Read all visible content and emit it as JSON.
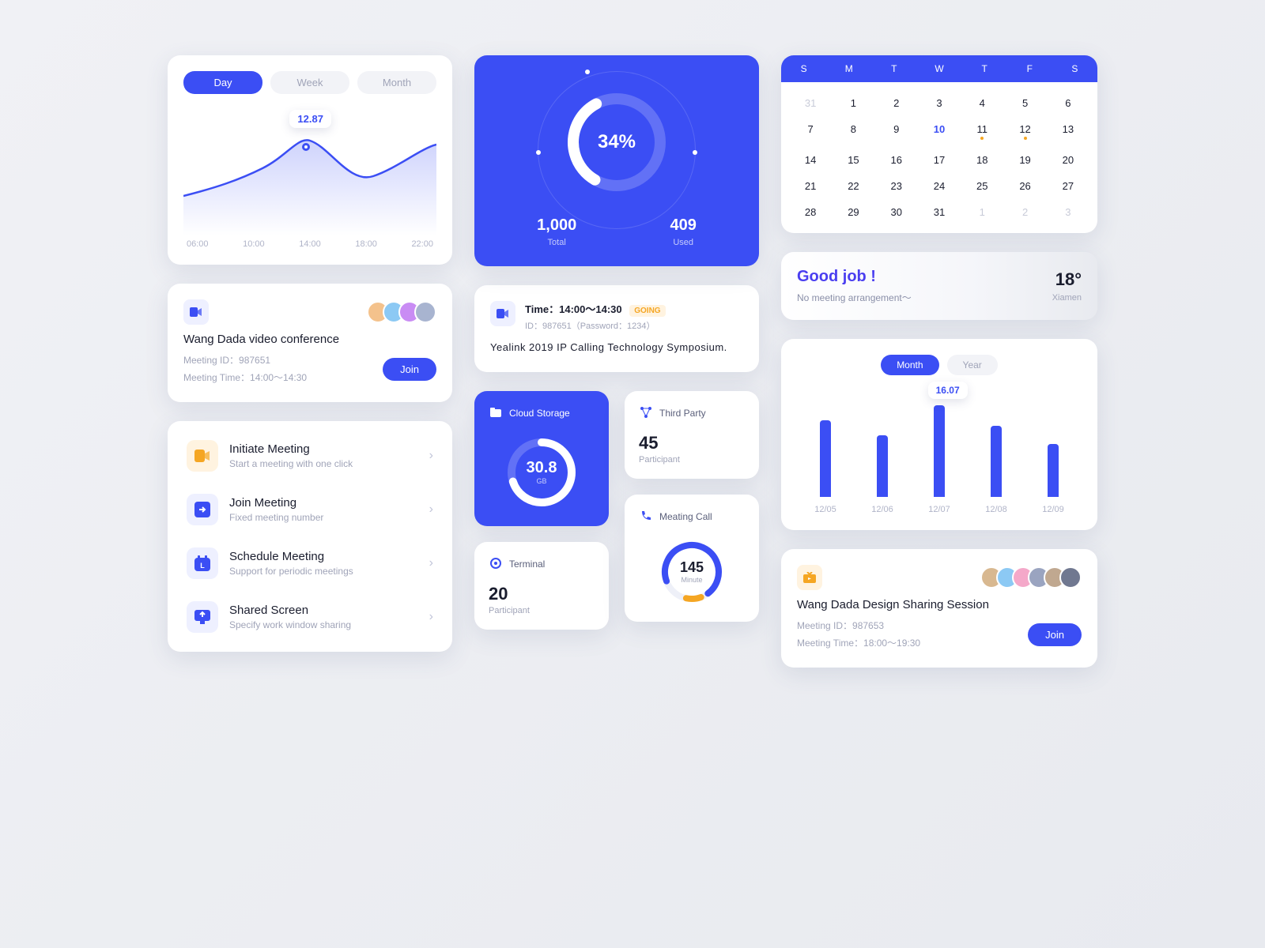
{
  "lineChart": {
    "tabs": [
      "Day",
      "Week",
      "Month"
    ],
    "activeTab": 0,
    "xaxis": [
      "06:00",
      "10:00",
      "14:00",
      "18:00",
      "22:00"
    ],
    "tooltipValue": "12.87"
  },
  "chart_data": [
    {
      "type": "line",
      "title": "",
      "x": [
        "06:00",
        "10:00",
        "14:00",
        "18:00",
        "22:00"
      ],
      "values": [
        6.5,
        8.5,
        12.87,
        9.2,
        11.8
      ],
      "highlight": {
        "x": "14:00",
        "value": 12.87
      },
      "ylim": [
        0,
        16
      ]
    },
    {
      "type": "bar",
      "title": "",
      "categories": [
        "12/05",
        "12/06",
        "12/07",
        "12/08",
        "12/09"
      ],
      "values": [
        13.5,
        10.8,
        16.07,
        12.5,
        9.3
      ],
      "highlight": {
        "x": "12/07",
        "value": 16.07
      },
      "ylim": [
        0,
        18
      ]
    }
  ],
  "meeting1": {
    "title": "Wang Dada  video conference",
    "idLabel": "Meeting ID：",
    "id": "987651",
    "timeLabel": "Meeting Time：",
    "time": "14:00～14:30",
    "joinLabel": "Join",
    "avatarColors": [
      "#f4c28c",
      "#8cc9f4",
      "#c98cf4",
      "#a8b4d0"
    ]
  },
  "actions": [
    {
      "title": "Initiate Meeting",
      "sub": "Start a meeting with one click",
      "bg": "#fff3e0",
      "fg": "#f5a623",
      "name": "video-icon"
    },
    {
      "title": "Join Meeting",
      "sub": "Fixed meeting number",
      "bg": "#eef0ff",
      "fg": "#3b4ef4",
      "name": "arrow-in-icon"
    },
    {
      "title": "Schedule Meeting",
      "sub": "Support for periodic meetings",
      "bg": "#eef0ff",
      "fg": "#3b4ef4",
      "name": "calendar-icon"
    },
    {
      "title": "Shared Screen",
      "sub": "Specify work window sharing",
      "bg": "#eef0ff",
      "fg": "#3b4ef4",
      "name": "screen-icon"
    }
  ],
  "usage": {
    "percent": "34%",
    "total": {
      "value": "1,000",
      "label": "Total"
    },
    "used": {
      "value": "409",
      "label": "Used"
    }
  },
  "event": {
    "timeLabel": "Time：",
    "time": "14:00～14:30",
    "badge": "GOING",
    "idLine": "ID：987651（Password：1234）",
    "desc": "Yealink 2019 IP Calling Technology Symposium."
  },
  "storage": {
    "title": "Cloud Storage",
    "value": "30.8",
    "unit": "GB"
  },
  "thirdParty": {
    "title": "Third Party",
    "value": "45",
    "label": "Participant"
  },
  "terminal": {
    "title": "Terminal",
    "value": "20",
    "label": "Participant"
  },
  "call": {
    "title": "Meating Call",
    "value": "145",
    "label": "Minute"
  },
  "calendar": {
    "weekdays": [
      "S",
      "M",
      "T",
      "W",
      "T",
      "F",
      "S"
    ],
    "days": [
      {
        "n": "31",
        "mute": true
      },
      {
        "n": "1"
      },
      {
        "n": "2"
      },
      {
        "n": "3"
      },
      {
        "n": "4"
      },
      {
        "n": "5"
      },
      {
        "n": "6"
      },
      {
        "n": "7"
      },
      {
        "n": "8"
      },
      {
        "n": "9"
      },
      {
        "n": "10",
        "sel": true
      },
      {
        "n": "11",
        "dot": true
      },
      {
        "n": "12",
        "dot": true
      },
      {
        "n": "13"
      },
      {
        "n": "14"
      },
      {
        "n": "15"
      },
      {
        "n": "16"
      },
      {
        "n": "17"
      },
      {
        "n": "18"
      },
      {
        "n": "19"
      },
      {
        "n": "20"
      },
      {
        "n": "21"
      },
      {
        "n": "22"
      },
      {
        "n": "23"
      },
      {
        "n": "24"
      },
      {
        "n": "25"
      },
      {
        "n": "26"
      },
      {
        "n": "27"
      },
      {
        "n": "28"
      },
      {
        "n": "29"
      },
      {
        "n": "30"
      },
      {
        "n": "31"
      },
      {
        "n": "1",
        "mute": true
      },
      {
        "n": "2",
        "mute": true
      },
      {
        "n": "3",
        "mute": true
      }
    ]
  },
  "goodjob": {
    "title": "Good job !",
    "sub": "No meeting arrangement～",
    "temp": "18°",
    "city": "Xiamen"
  },
  "barChart": {
    "tabs": [
      "Month",
      "Year"
    ],
    "activeTab": 0,
    "xaxis": [
      "12/05",
      "12/06",
      "12/07",
      "12/08",
      "12/09"
    ],
    "tooltipValue": "16.07"
  },
  "meeting2": {
    "title": "Wang Dada  Design Sharing Session",
    "idLabel": "Meeting ID：",
    "id": "987653",
    "timeLabel": "Meeting Time：",
    "time": "18:00～19:30",
    "joinLabel": "Join",
    "avatarColors": [
      "#d8b890",
      "#8cc9f4",
      "#f4a8c9",
      "#9aa4c0",
      "#c0a890",
      "#707890"
    ]
  }
}
